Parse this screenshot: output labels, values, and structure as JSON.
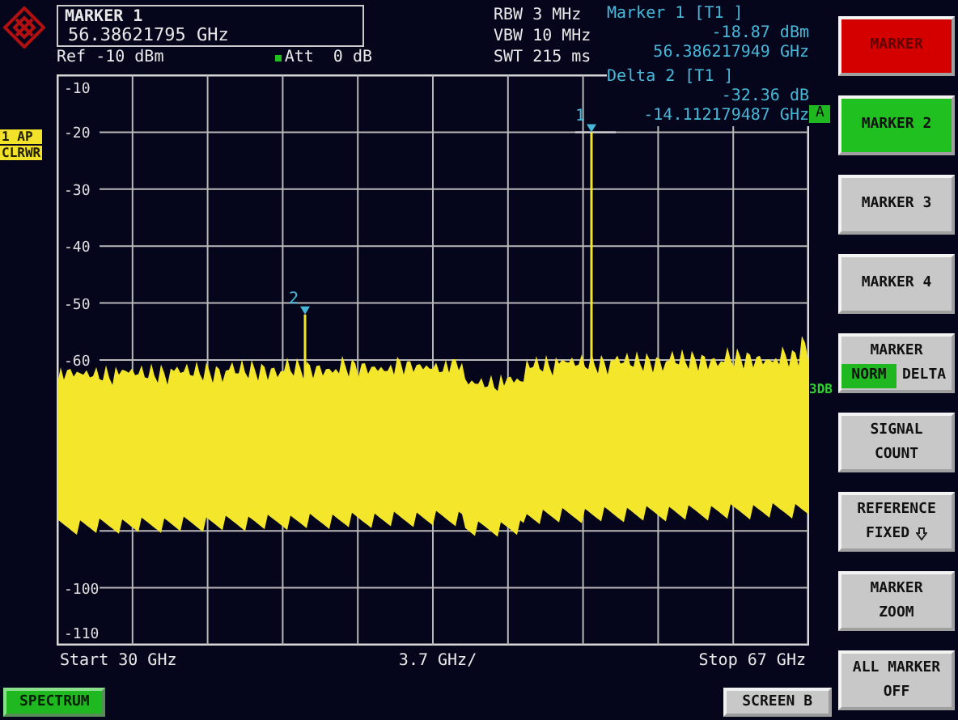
{
  "marker_box": {
    "title": "MARKER 1",
    "value": "56.38621795 GHz"
  },
  "ref": "Ref -10 dBm",
  "att": "Att  0 dB",
  "settings": [
    "RBW 3 MHz",
    "VBW 10 MHz",
    "SWT 215 ms"
  ],
  "marker_readouts": [
    {
      "title": "Marker 1 [T1 ]",
      "amplitude": "-18.87 dBm",
      "frequency": "56.386217949 GHz"
    },
    {
      "title": "Delta 2 [T1 ]",
      "amplitude": "-32.36 dB",
      "frequency": "-14.112179487 GHz"
    }
  ],
  "trace_labels": [
    "1 AP",
    "CLRWR"
  ],
  "y_labels": [
    "-10",
    "-20",
    "-30",
    "-40",
    "-50",
    "-60",
    "-100",
    "-110"
  ],
  "plot_markers": [
    {
      "label": "1"
    },
    {
      "label": "2"
    }
  ],
  "channel_badge": "A",
  "side_label": "3DB",
  "x_axis": {
    "start": "Start 30 GHz",
    "span": "3.7 GHz/",
    "stop": "Stop 67 GHz"
  },
  "softkeys": [
    {
      "kind": "button",
      "lines": [
        "MARKER"
      ],
      "color": "#d40000"
    },
    {
      "kind": "button",
      "lines": [
        "MARKER 2"
      ],
      "color": "#20c020"
    },
    {
      "kind": "button",
      "lines": [
        "MARKER 3"
      ],
      "color": "#c8c8c8"
    },
    {
      "kind": "button",
      "lines": [
        "MARKER 4"
      ],
      "color": "#c8c8c8"
    },
    {
      "kind": "toggle",
      "lines": [
        "MARKER"
      ],
      "color": "#c8c8c8",
      "options": [
        {
          "label": "NORM",
          "selected": true
        },
        {
          "label": "DELTA",
          "selected": false
        }
      ]
    },
    {
      "kind": "button",
      "lines": [
        "SIGNAL",
        "COUNT"
      ],
      "color": "#c8c8c8"
    },
    {
      "kind": "menu",
      "lines": [
        "REFERENCE",
        "FIXED"
      ],
      "color": "#c8c8c8"
    },
    {
      "kind": "button",
      "lines": [
        "MARKER",
        "ZOOM"
      ],
      "color": "#c8c8c8"
    },
    {
      "kind": "button",
      "lines": [
        "ALL MARKER",
        "OFF"
      ],
      "color": "#c8c8c8"
    }
  ],
  "bottom": {
    "mode": "SPECTRUM",
    "screen": "SCREEN B"
  }
}
